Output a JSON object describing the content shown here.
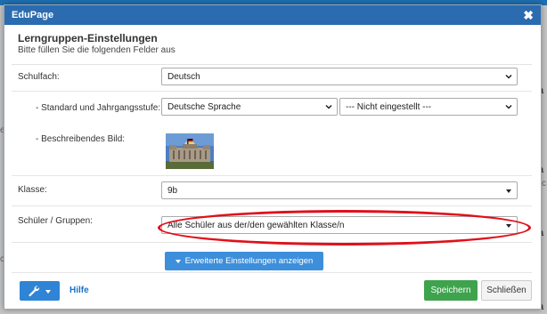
{
  "dialog": {
    "title": "EduPage",
    "close_glyph": "✖",
    "heading": "Lerngruppen-Einstellungen",
    "subheading": "Bitte füllen Sie die folgenden Felder aus"
  },
  "form": {
    "subject": {
      "label": "Schulfach:",
      "value": "Deutsch"
    },
    "standard": {
      "label": "- Standard und Jahrgangsstufe:",
      "value": "Deutsche Sprache",
      "grade_value": "--- Nicht eingestellt ---"
    },
    "image": {
      "label": "- Beschreibendes Bild:"
    },
    "class": {
      "label": "Klasse:",
      "value": "9b"
    },
    "students": {
      "label": "Schüler / Gruppen:",
      "value": "Alle Schüler aus der/den gewählten Klasse/n"
    },
    "advanced_button": "Erweiterte Einstellungen anzeigen"
  },
  "footer": {
    "tools_icon": "wrench-icon",
    "help_label": "Hilfe",
    "save_label": "Speichern",
    "close_label": "Schließen"
  },
  "background_fragments": [
    "a",
    "a",
    "a",
    "a",
    "e",
    "c",
    "c"
  ],
  "colors": {
    "titlebar": "#2b6bb0",
    "primary": "#3d8fdb",
    "save": "#3fa34d",
    "highlight": "#e0101a"
  }
}
